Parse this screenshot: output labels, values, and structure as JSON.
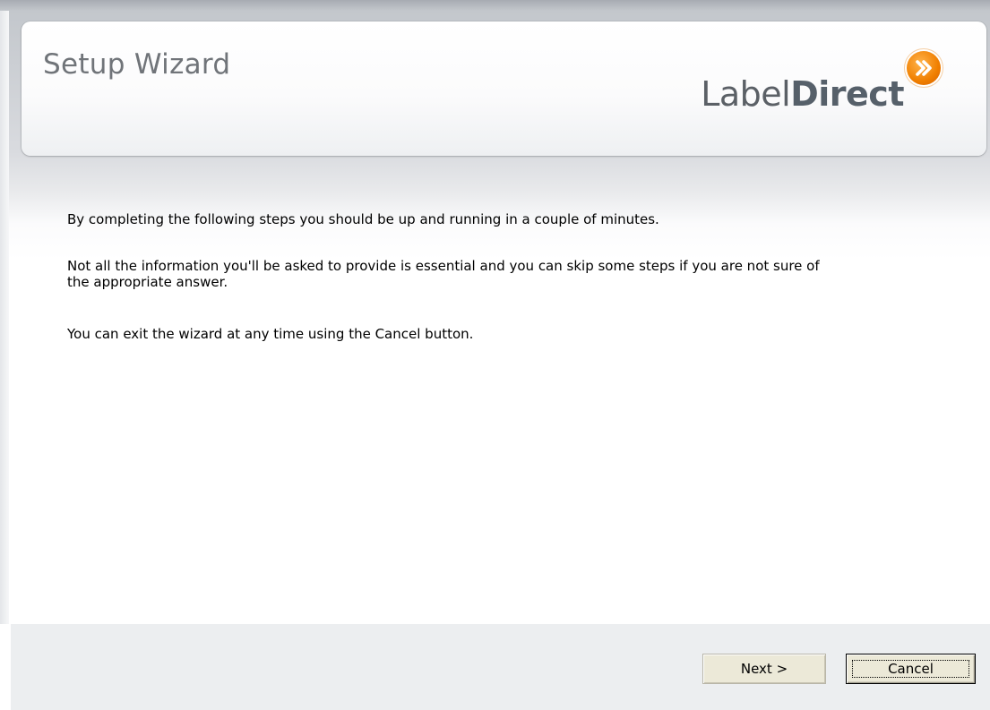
{
  "header": {
    "title": "Setup Wizard",
    "brand_part1": "Label",
    "brand_part2": "Direct",
    "logo_icon": "double-chevron-right-icon",
    "logo_color": "#f07f00"
  },
  "content": {
    "paragraphs": [
      "By completing the following steps you should be up and running in a couple of minutes.",
      "Not all the information you'll be asked to provide is essential and you can skip some steps if you are not sure of the appropriate answer.",
      "You can exit the wizard at any time using the Cancel button."
    ]
  },
  "footer": {
    "next_label": "Next >",
    "cancel_label": "Cancel"
  }
}
